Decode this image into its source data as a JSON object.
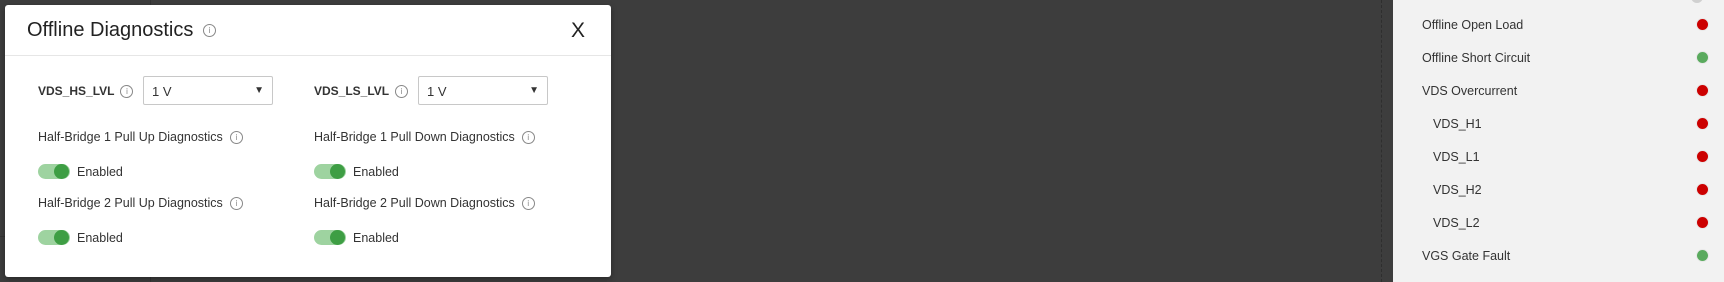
{
  "dialog": {
    "title": "Offline Diagnostics",
    "close_label": "X",
    "vds_hs": {
      "label": "VDS_HS_LVL",
      "value": "1 V"
    },
    "vds_ls": {
      "label": "VDS_LS_LVL",
      "value": "1 V"
    },
    "diagnostics": [
      {
        "label": "Half-Bridge 1 Pull Up Diagnostics",
        "state": "Enabled"
      },
      {
        "label": "Half-Bridge 1 Pull Down Diagnostics",
        "state": "Enabled"
      },
      {
        "label": "Half-Bridge 2 Pull Up Diagnostics",
        "state": "Enabled"
      },
      {
        "label": "Half-Bridge 2 Pull Down Diagnostics",
        "state": "Enabled"
      }
    ]
  },
  "status_panel": {
    "items": [
      {
        "label": "Offline Open Load",
        "status": "red"
      },
      {
        "label": "Offline Short Circuit",
        "status": "green"
      },
      {
        "label": "VDS Overcurrent",
        "status": "red"
      },
      {
        "label": "VDS_H1",
        "status": "red"
      },
      {
        "label": "VDS_L1",
        "status": "red"
      },
      {
        "label": "VDS_H2",
        "status": "red"
      },
      {
        "label": "VDS_L2",
        "status": "red"
      },
      {
        "label": "VGS Gate Fault",
        "status": "green"
      }
    ]
  },
  "colors": {
    "red": "#cc0000",
    "green": "#5aaa5e",
    "toggle_on": "#3e9e44"
  }
}
